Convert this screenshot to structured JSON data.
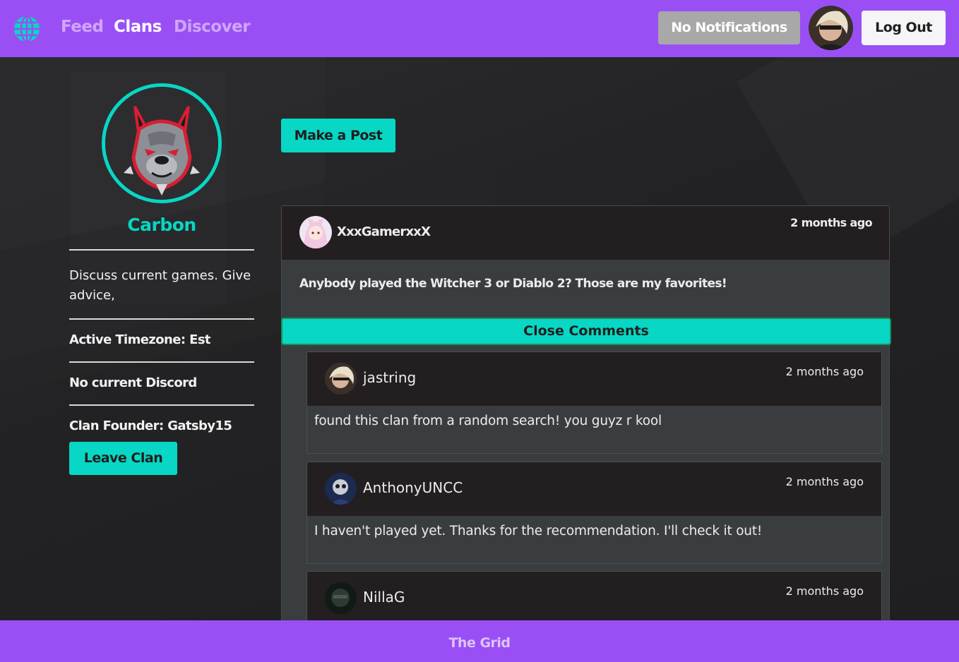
{
  "nav": {
    "links": [
      "Feed",
      "Clans",
      "Discover"
    ],
    "notifications_label": "No Notifications",
    "logout_label": "Log Out"
  },
  "clan": {
    "name": "Carbon",
    "description": "Discuss current games. Give advice,",
    "timezone": "Active Timezone: Est",
    "discord": "No current Discord",
    "founder": "Clan Founder: Gatsby15",
    "leave_label": "Leave Clan"
  },
  "main": {
    "make_post_label": "Make a Post",
    "post": {
      "author": "XxxGamerxxX",
      "time": "2 months ago",
      "body": "Anybody played the Witcher 3 or Diablo 2? Those are my favorites!",
      "close_comments_label": "Close Comments"
    },
    "comments": [
      {
        "author": "jastring",
        "time": "2 months ago",
        "body": "found this clan from a random search! you guyz r kool"
      },
      {
        "author": "AnthonyUNCC",
        "time": "2 months ago",
        "body": "I haven't played yet. Thanks for the recommendation. I'll check it out!"
      },
      {
        "author": "NillaG",
        "time": "2 months ago",
        "body": ""
      }
    ]
  },
  "footer": {
    "text": "The Grid"
  },
  "colors": {
    "brand": "#9a4ff5",
    "accent": "#07d7c4",
    "dark": "#231f20"
  },
  "icons": [
    "globe-icon",
    "pitbull-clan-logo",
    "user-avatar"
  ]
}
